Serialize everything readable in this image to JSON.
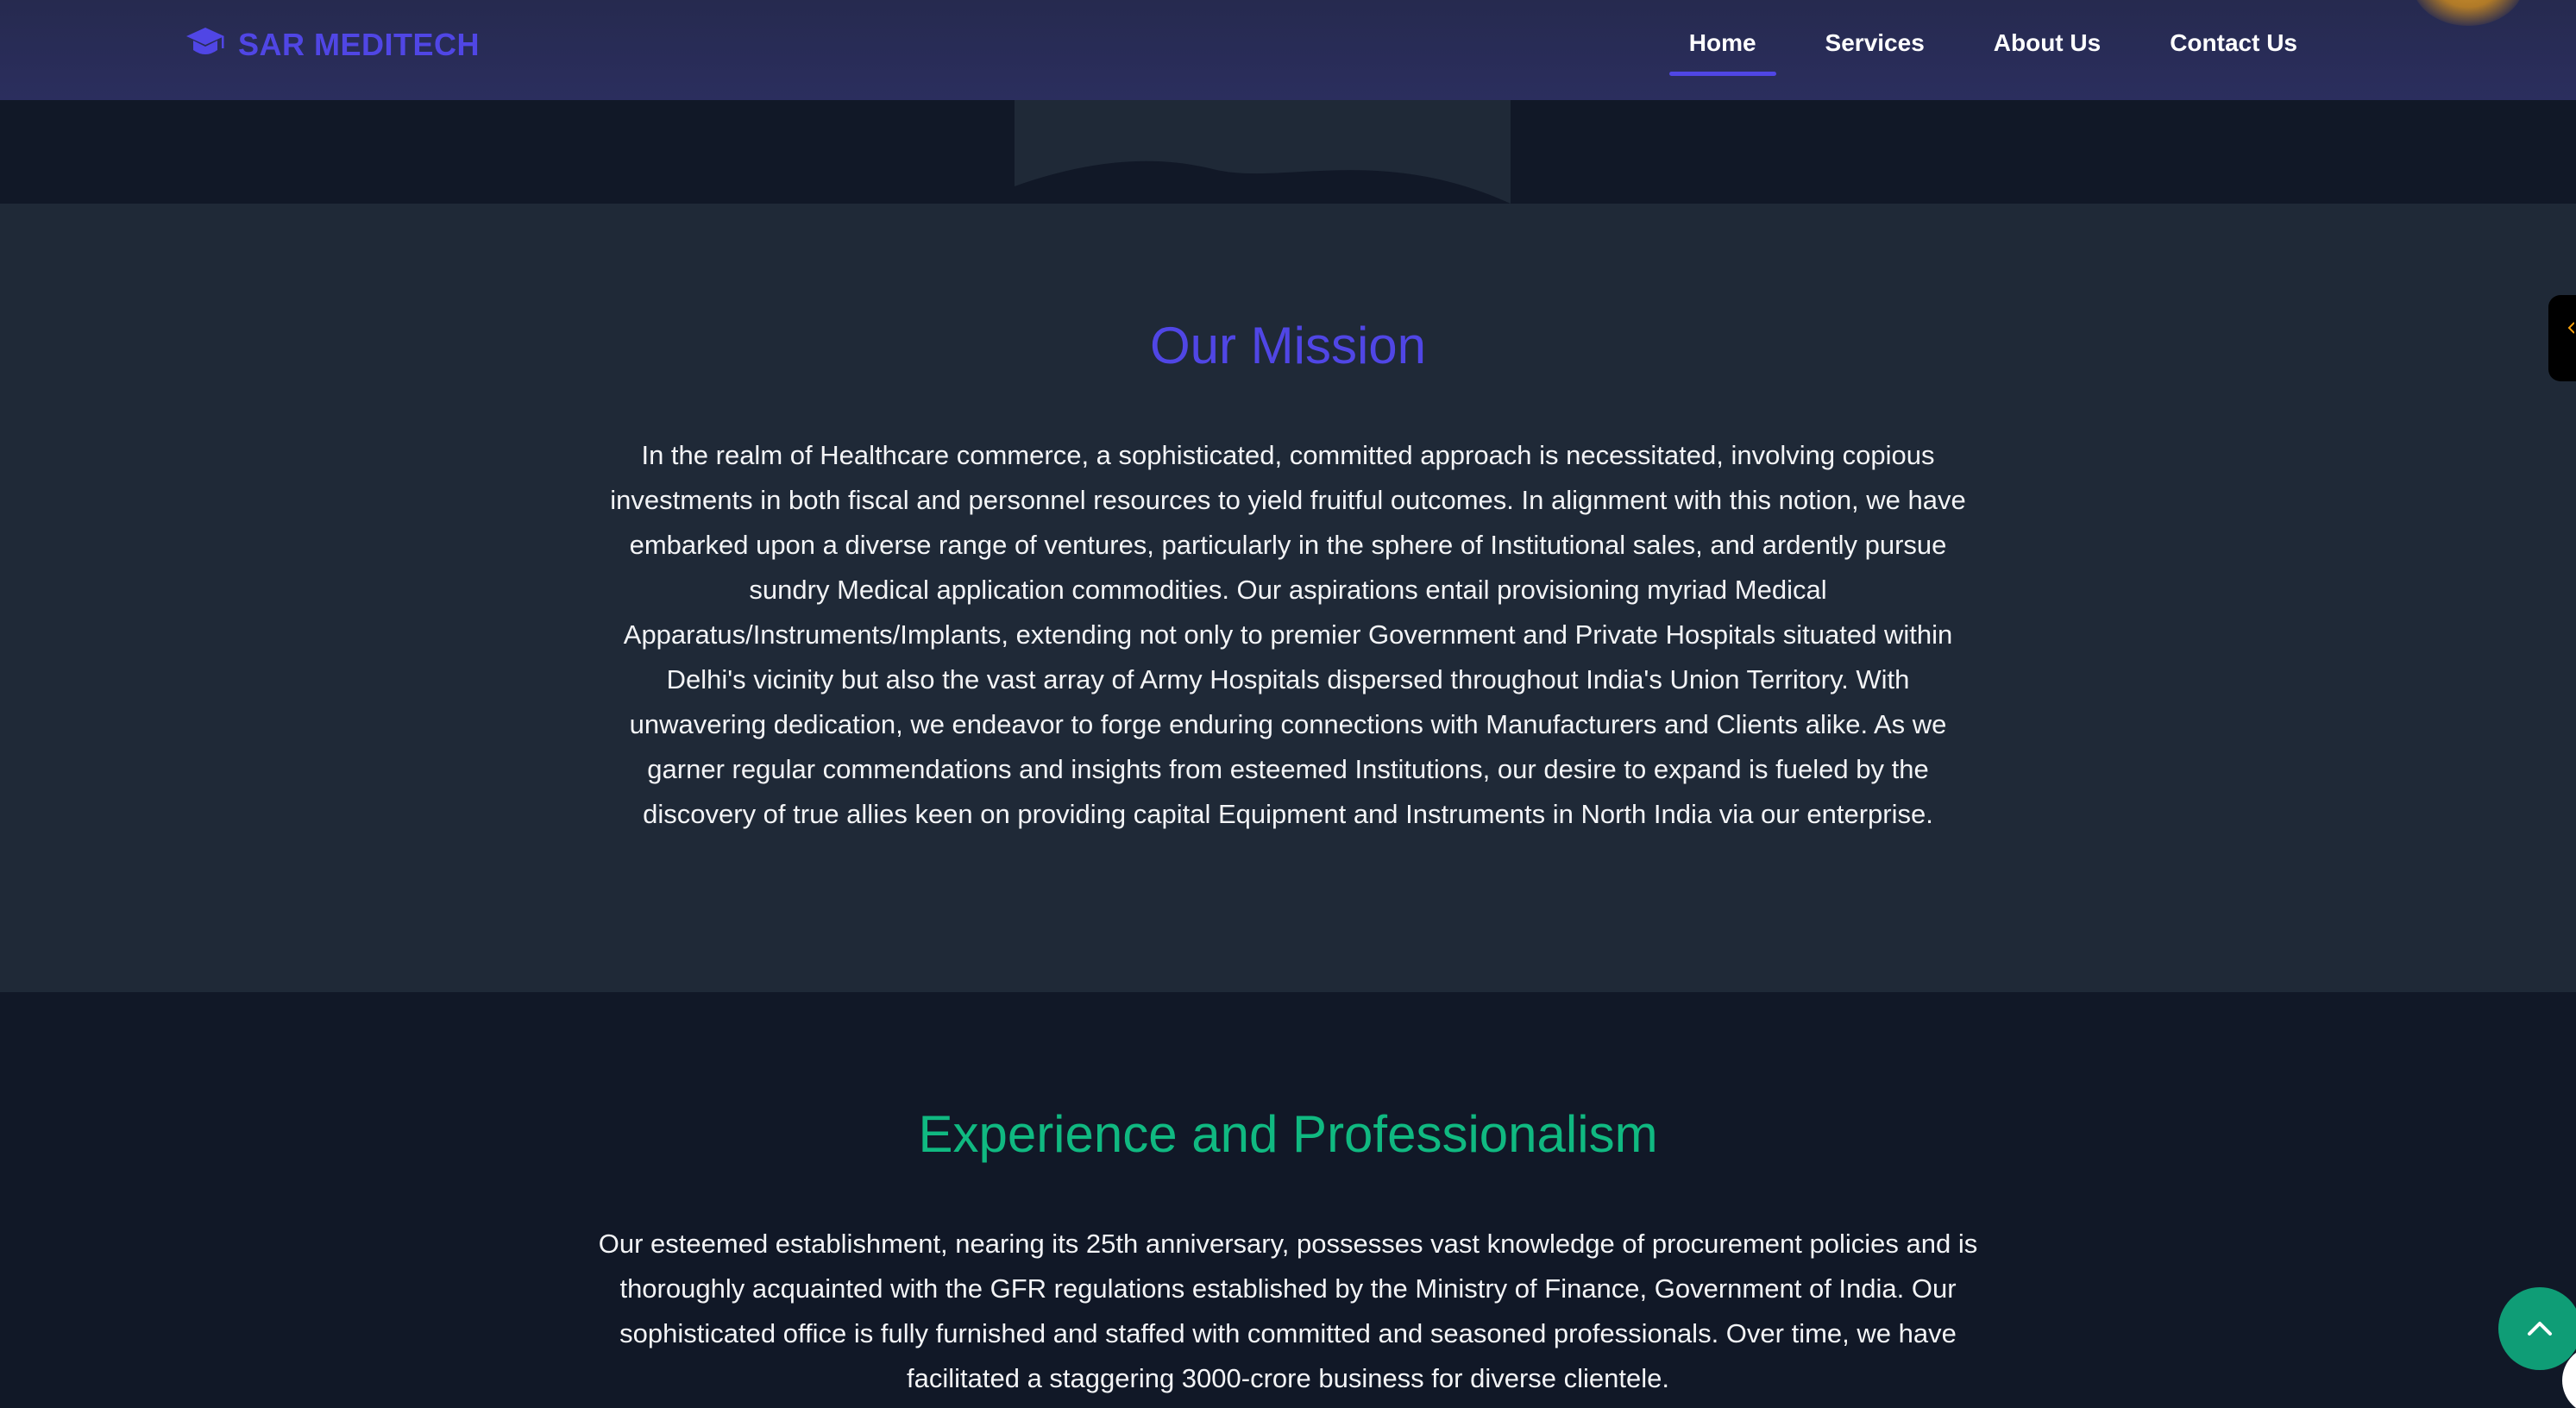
{
  "header": {
    "brand_name": "SAR MEDITECH",
    "brand_icon": "graduation-cap-icon",
    "nav": [
      {
        "label": "Home",
        "active": true
      },
      {
        "label": "Services",
        "active": false
      },
      {
        "label": "About Us",
        "active": false
      },
      {
        "label": "Contact Us",
        "active": false
      }
    ]
  },
  "mission": {
    "title": "Our Mission",
    "body": "In the realm of Healthcare commerce, a sophisticated, committed approach is necessitated, involving copious investments in both fiscal and personnel resources to yield fruitful outcomes. In alignment with this notion, we have embarked upon a diverse range of ventures, particularly in the sphere of Institutional sales, and ardently pursue sundry Medical application commodities. Our aspirations entail provisioning myriad Medical Apparatus/Instruments/Implants, extending not only to premier Government and Private Hospitals situated within Delhi's vicinity but also the vast array of Army Hospitals dispersed throughout India's Union Territory. With unwavering dedication, we endeavor to forge enduring connections with Manufacturers and Clients alike. As we garner regular commendations and insights from esteemed Institutions, our desire to expand is fueled by the discovery of true allies keen on providing capital Equipment and Instruments in North India via our enterprise."
  },
  "experience": {
    "title": "Experience and Professionalism",
    "body": "Our esteemed establishment, nearing its 25th anniversary, possesses vast knowledge of procurement policies and is thoroughly acquainted with the GFR regulations established by the Ministry of Finance, Government of India. Our sophisticated office is fully furnished and staffed with committed and seasoned professionals. Over time, we have facilitated a staggering 3000-crore business for diverse clientele."
  },
  "widgets": {
    "scroll_top_icon": "chevron-up-icon",
    "side_tab_icon": "star-icon"
  },
  "colors": {
    "header_bg": "#2b2e5e",
    "brand": "#5046e5",
    "mission_title": "#5046e5",
    "experience_title": "#10b981",
    "section_dark": "#111827",
    "section_mid": "#1f2937",
    "scroll_button": "#0f9d76"
  }
}
